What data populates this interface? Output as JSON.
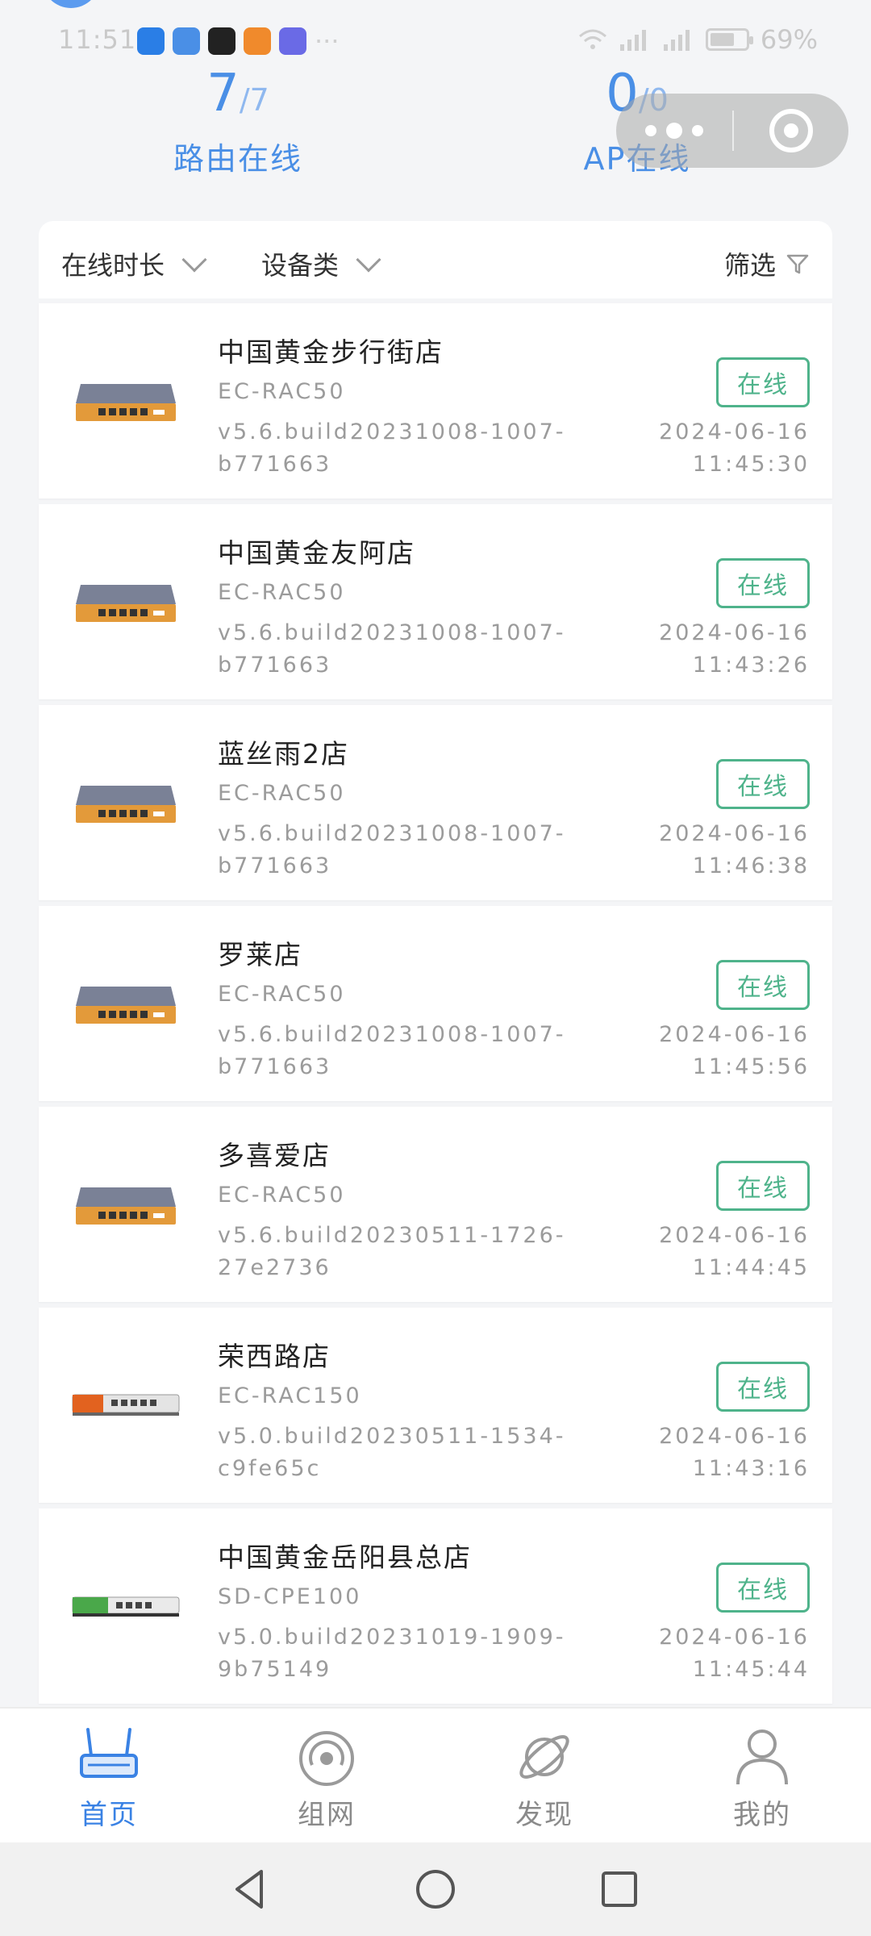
{
  "status_bar": {
    "time": "11:51",
    "battery": "69%",
    "battery_level": 0.69,
    "app_icons": [
      "browser-icon",
      "weather-icon",
      "soul-icon",
      "video-icon",
      "music-icon",
      "more-dots"
    ],
    "more": "···"
  },
  "stats": {
    "router": {
      "online": "7",
      "total": "/7",
      "label": "路由在线"
    },
    "ap": {
      "online": "0",
      "total": "/0",
      "label": "AP在线"
    }
  },
  "filter_bar": {
    "duration": "在线时长",
    "device_type": "设备类",
    "filter": "筛选"
  },
  "devices": [
    {
      "name": "中国黄金步行街店",
      "model": "EC-RAC50",
      "version_line1": "v5.6.build20231008-1007-",
      "version_line2": "b771663",
      "status": "在线",
      "date": "2024-06-16",
      "time": "11:45:30",
      "image": "router-gray"
    },
    {
      "name": "中国黄金友阿店",
      "model": "EC-RAC50",
      "version_line1": "v5.6.build20231008-1007-",
      "version_line2": "b771663",
      "status": "在线",
      "date": "2024-06-16",
      "time": "11:43:26",
      "image": "router-gray"
    },
    {
      "name": "蓝丝雨2店",
      "model": "EC-RAC50",
      "version_line1": "v5.6.build20231008-1007-",
      "version_line2": "b771663",
      "status": "在线",
      "date": "2024-06-16",
      "time": "11:46:38",
      "image": "router-gray"
    },
    {
      "name": "罗莱店",
      "model": "EC-RAC50",
      "version_line1": "v5.6.build20231008-1007-",
      "version_line2": "b771663",
      "status": "在线",
      "date": "2024-06-16",
      "time": "11:45:56",
      "image": "router-gray"
    },
    {
      "name": "多喜爱店",
      "model": "EC-RAC50",
      "version_line1": "v5.6.build20230511-1726-",
      "version_line2": "27e2736",
      "status": "在线",
      "date": "2024-06-16",
      "time": "11:44:45",
      "image": "router-gray"
    },
    {
      "name": "荣西路店",
      "model": "EC-RAC150",
      "version_line1": "v5.0.build20230511-1534-",
      "version_line2": "c9fe65c",
      "status": "在线",
      "date": "2024-06-16",
      "time": "11:43:16",
      "image": "router-orange"
    },
    {
      "name": "中国黄金岳阳县总店",
      "model": "SD-CPE100",
      "version_line1": "v5.0.build20231019-1909-",
      "version_line2": "9b75149",
      "status": "在线",
      "date": "2024-06-16",
      "time": "11:45:44",
      "image": "router-green"
    }
  ],
  "tabs": [
    {
      "label": "首页",
      "icon": "router-icon",
      "active": true
    },
    {
      "label": "组网",
      "icon": "signal-icon",
      "active": false
    },
    {
      "label": "发现",
      "icon": "planet-icon",
      "active": false
    },
    {
      "label": "我的",
      "icon": "user-icon",
      "active": false
    }
  ],
  "colors": {
    "accent": "#3a82e4",
    "online": "#4fb38b",
    "muted_text": "#9b9b9b",
    "background": "#f4f5f7"
  }
}
